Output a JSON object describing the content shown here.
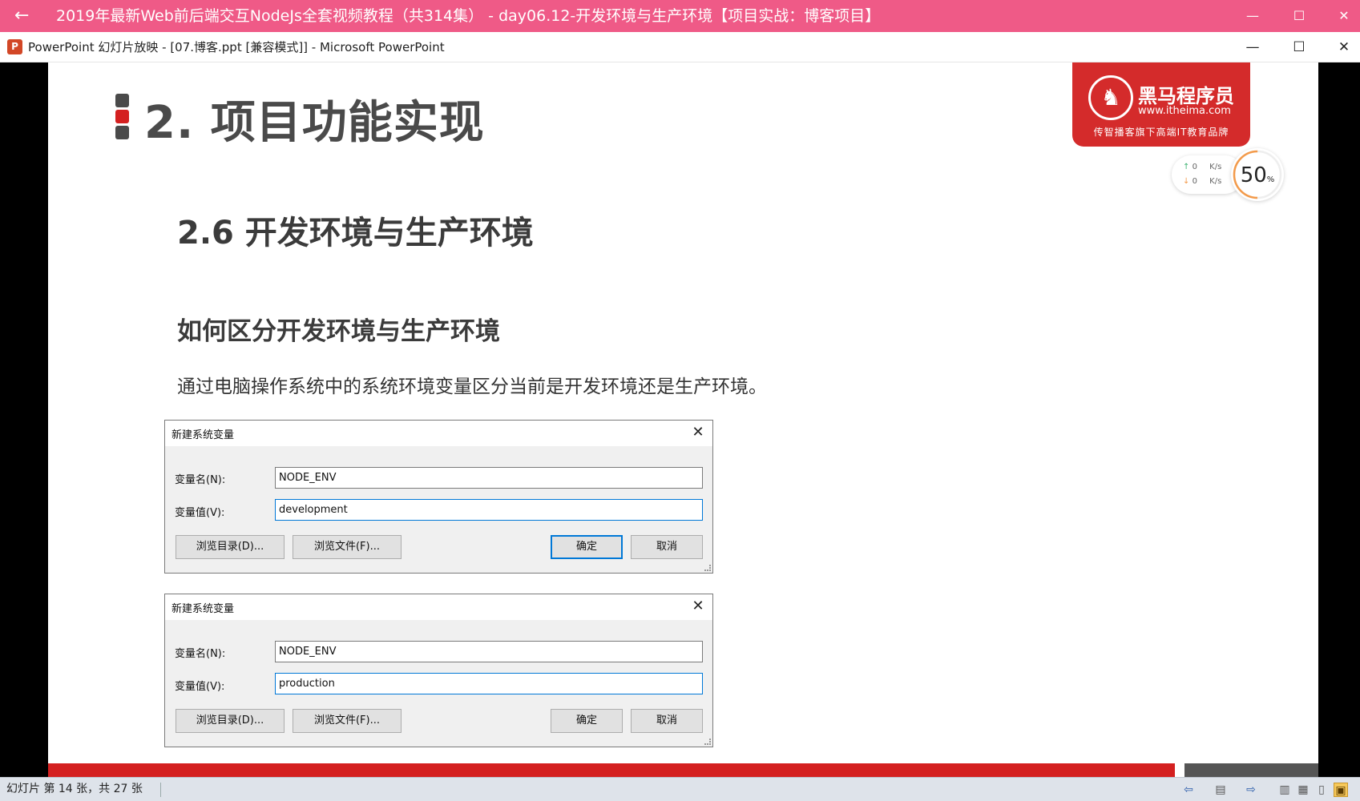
{
  "player": {
    "title": "2019年最新Web前后端交互NodeJs全套视频教程（共314集） - day06.12-开发环境与生产环境【项目实战：博客项目】",
    "back_icon": "←",
    "minimize_icon": "—",
    "maximize_icon": "☐",
    "close_icon": "✕"
  },
  "ppt_window": {
    "app_icon": "P",
    "title": "PowerPoint 幻灯片放映 - [07.博客.ppt [兼容模式]] - Microsoft PowerPoint",
    "minimize_icon": "—",
    "maximize_icon": "☐",
    "close_icon": "✕"
  },
  "slide": {
    "title": "2. 项目功能实现",
    "section_title": "2.6 开发环境与生产环境",
    "sub_heading": "如何区分开发环境与生产环境",
    "description": "通过电脑操作系统中的系统环境变量区分当前是开发环境还是生产环境。",
    "bullet_colors": [
      "#4a4a4a",
      "#d42020",
      "#4a4a4a"
    ],
    "logo": {
      "name": "黑马程序员",
      "url": "www.itheima.com",
      "slogan": "传智播客旗下高端IT教育品牌",
      "emblem_icon": "horse-icon"
    },
    "brand_color": "#d42b2b"
  },
  "net_widget": {
    "upload_arrow": "↑",
    "download_arrow": "↓",
    "upload": "0",
    "download": "0",
    "unit": "K/s",
    "percent": "50",
    "percent_sign": "%",
    "percent_value": 50,
    "ring_color": "#f39a4a"
  },
  "dialogs": [
    {
      "title": "新建系统变量",
      "name_label": "变量名(N):",
      "value_label": "变量值(V):",
      "name_value": "NODE_ENV",
      "value_value": "development",
      "browse_dir": "浏览目录(D)...",
      "browse_file": "浏览文件(F)...",
      "ok": "确定",
      "cancel": "取消",
      "close_icon": "✕"
    },
    {
      "title": "新建系统变量",
      "name_label": "变量名(N):",
      "value_label": "变量值(V):",
      "name_value": "NODE_ENV",
      "value_value": "production",
      "browse_dir": "浏览目录(D)...",
      "browse_file": "浏览文件(F)...",
      "ok": "确定",
      "cancel": "取消",
      "close_icon": "✕"
    }
  ],
  "status_bar": {
    "slide_info": "幻灯片 第 14 张，共 27 张",
    "icons": {
      "prev": "⇦",
      "menu": "▤",
      "next": "⇨",
      "normal_view": "▥",
      "sorter_view": "▦",
      "reading_view": "▯",
      "slideshow_view": "▣"
    }
  }
}
